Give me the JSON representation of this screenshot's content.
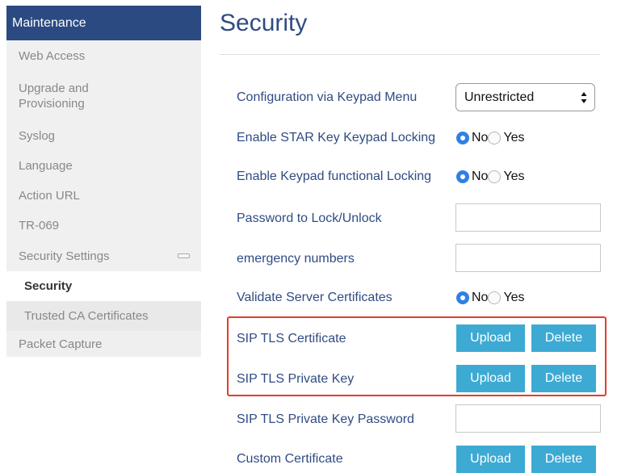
{
  "sidebar": {
    "header": "Maintenance",
    "items": [
      {
        "label": "Web Access"
      },
      {
        "label_line1": "Upgrade and",
        "label_line2": "Provisioning"
      },
      {
        "label": "Syslog"
      },
      {
        "label": "Language"
      },
      {
        "label": "Action URL"
      },
      {
        "label": "TR-069"
      },
      {
        "label": "Security Settings",
        "icon": "collapse-icon"
      },
      {
        "label": "Security",
        "active": true
      },
      {
        "label": "Trusted CA Certificates"
      },
      {
        "label": "Packet Capture"
      }
    ]
  },
  "main": {
    "title": "Security",
    "rows": [
      {
        "label": "Configuration via Keypad Menu",
        "control": "select",
        "value": "Unrestricted"
      },
      {
        "label": "Enable STAR Key Keypad Locking",
        "control": "radio",
        "options": [
          "No",
          "Yes"
        ],
        "selected": "No"
      },
      {
        "label": "Enable Keypad functional Locking",
        "control": "radio",
        "options": [
          "No",
          "Yes"
        ],
        "selected": "No"
      },
      {
        "label": "Password to Lock/Unlock",
        "control": "text",
        "value": ""
      },
      {
        "label": "emergency numbers",
        "control": "text",
        "value": ""
      },
      {
        "label": "Validate Server Certificates",
        "control": "radio",
        "options": [
          "No",
          "Yes"
        ],
        "selected": "No"
      },
      {
        "label": "SIP TLS Certificate",
        "control": "buttons",
        "buttons": [
          "Upload",
          "Delete"
        ]
      },
      {
        "label": "SIP TLS Private Key",
        "control": "buttons",
        "buttons": [
          "Upload",
          "Delete"
        ]
      },
      {
        "label": "SIP TLS Private Key Password",
        "control": "text",
        "value": ""
      },
      {
        "label": "Custom Certificate",
        "control": "buttons",
        "buttons": [
          "Upload",
          "Delete"
        ]
      }
    ]
  },
  "colors": {
    "header_bg": "#2b4a82",
    "title": "#2f4c83",
    "button": "#3daad3",
    "radio_selected": "#2f80e4",
    "highlight": "#e63b2e"
  }
}
